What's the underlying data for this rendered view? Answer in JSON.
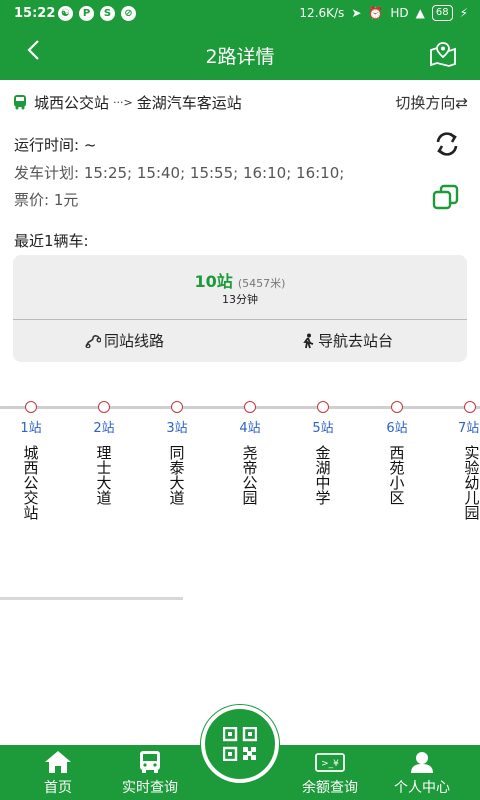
{
  "status_bar": {
    "time": "15:22",
    "app_badges": [
      "☯",
      "P",
      "S",
      "⊘"
    ],
    "network_speed": "12.6K/s",
    "battery": "68"
  },
  "header": {
    "title": "2路详情",
    "back_icon": "chevron-left-icon",
    "map_icon": "map-pin-icon"
  },
  "route": {
    "from": "城西公交站",
    "arrow": "···>",
    "to": "金湖汽车客运站",
    "switch_label": "切换方向⇄"
  },
  "info": {
    "operating_time": "运行时间: ~",
    "schedule": "发车计划: 15:25; 15:40; 15:55; 16:10; 16:10;",
    "fare": "票价:  1元",
    "recent_bus_label": "最近1辆车:"
  },
  "bus_card": {
    "stops_away": "10站",
    "distance": "(5457米)",
    "minutes": "13分钟",
    "same_station_btn": "同站线路",
    "navigate_btn": "导航去站台"
  },
  "stations": [
    {
      "num": "1站",
      "name": "城西公交站"
    },
    {
      "num": "2站",
      "name": "理士大道"
    },
    {
      "num": "3站",
      "name": "同泰大道"
    },
    {
      "num": "4站",
      "name": "尧帝公园"
    },
    {
      "num": "5站",
      "name": "金湖中学"
    },
    {
      "num": "6站",
      "name": "西苑小区"
    },
    {
      "num": "7站",
      "name": "实验幼儿园"
    }
  ],
  "bottom_nav": {
    "home": "首页",
    "realtime": "实时查询",
    "balance": "余额查询",
    "profile": "个人中心"
  },
  "colors": {
    "primary_green": "#1d9a3a",
    "station_blue": "#2d63c4",
    "station_dot": "#c23a3a"
  }
}
